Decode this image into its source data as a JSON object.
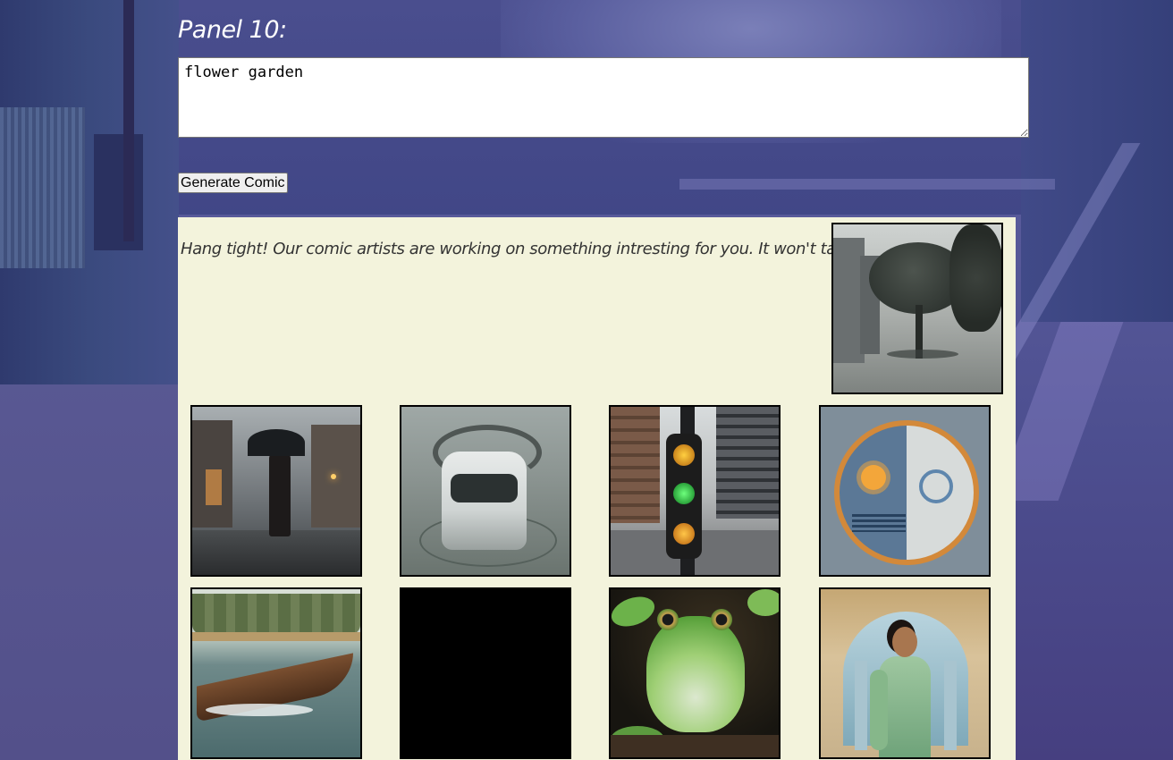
{
  "form": {
    "panel_label": "Panel 10:",
    "panel_prompt": "flower garden",
    "generate_label": "Generate Comic"
  },
  "results": {
    "loading_message": "Hang tight! Our comic artists are working on something intresting for you. It won't take long!",
    "featured_image": "tree-in-rain",
    "images": [
      "woman-with-umbrella-in-rain",
      "white-car-in-water",
      "traffic-lights",
      "sun-and-moon-emblem",
      "wooden-boat-on-river",
      "black-image",
      "green-frog",
      "woman-in-green-sari-temple"
    ]
  },
  "colors": {
    "result_background": "#f3f3dc",
    "page_background": "#4a4e8e"
  }
}
